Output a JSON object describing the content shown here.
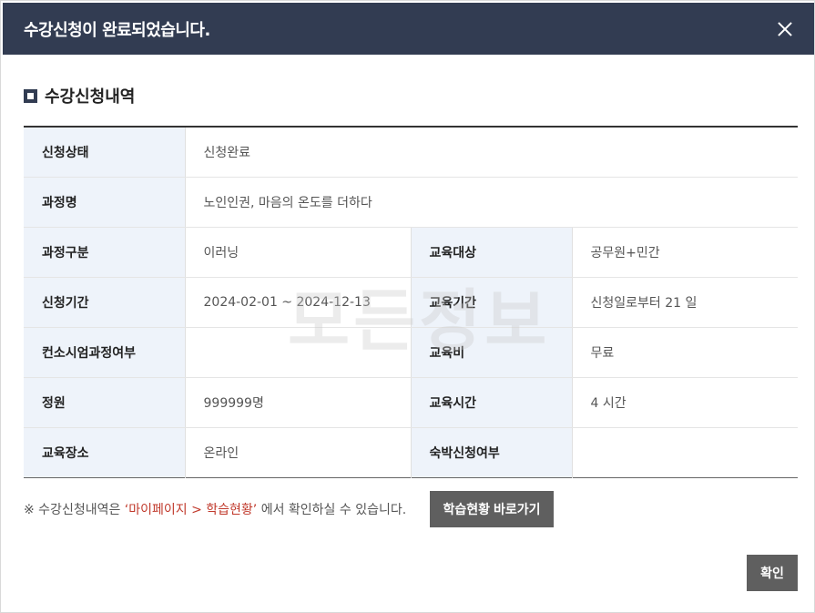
{
  "header": {
    "title": "수강신청이 완료되었습니다."
  },
  "section": {
    "title": "수강신청내역"
  },
  "table": {
    "status_label": "신청상태",
    "status_value": "신청완료",
    "course_name_label": "과정명",
    "course_name_value": "노인인권, 마음의 온도를 더하다",
    "course_type_label": "과정구분",
    "course_type_value": "이러닝",
    "target_label": "교육대상",
    "target_value": "공무원+민간",
    "apply_period_label": "신청기간",
    "apply_period_value": "2024-02-01 ~ 2024-12-13",
    "edu_period_label": "교육기간",
    "edu_period_value": "신청일로부터 21 일",
    "consortium_label": "컨소시엄과정여부",
    "consortium_value": "",
    "fee_label": "교육비",
    "fee_value": "무료",
    "capacity_label": "정원",
    "capacity_value": "999999명",
    "hours_label": "교육시간",
    "hours_value": "4 시간",
    "location_label": "교육장소",
    "location_value": "온라인",
    "lodging_label": "숙박신청여부",
    "lodging_value": ""
  },
  "watermark": "모든정보",
  "notice": {
    "prefix": "※ 수강신청내역은 ",
    "highlight": "‘마이페이지 > 학습현황’",
    "suffix": " 에서 확인하실 수 있습니다."
  },
  "buttons": {
    "go_label": "학습현황 바로가기",
    "ok_label": "확인"
  }
}
